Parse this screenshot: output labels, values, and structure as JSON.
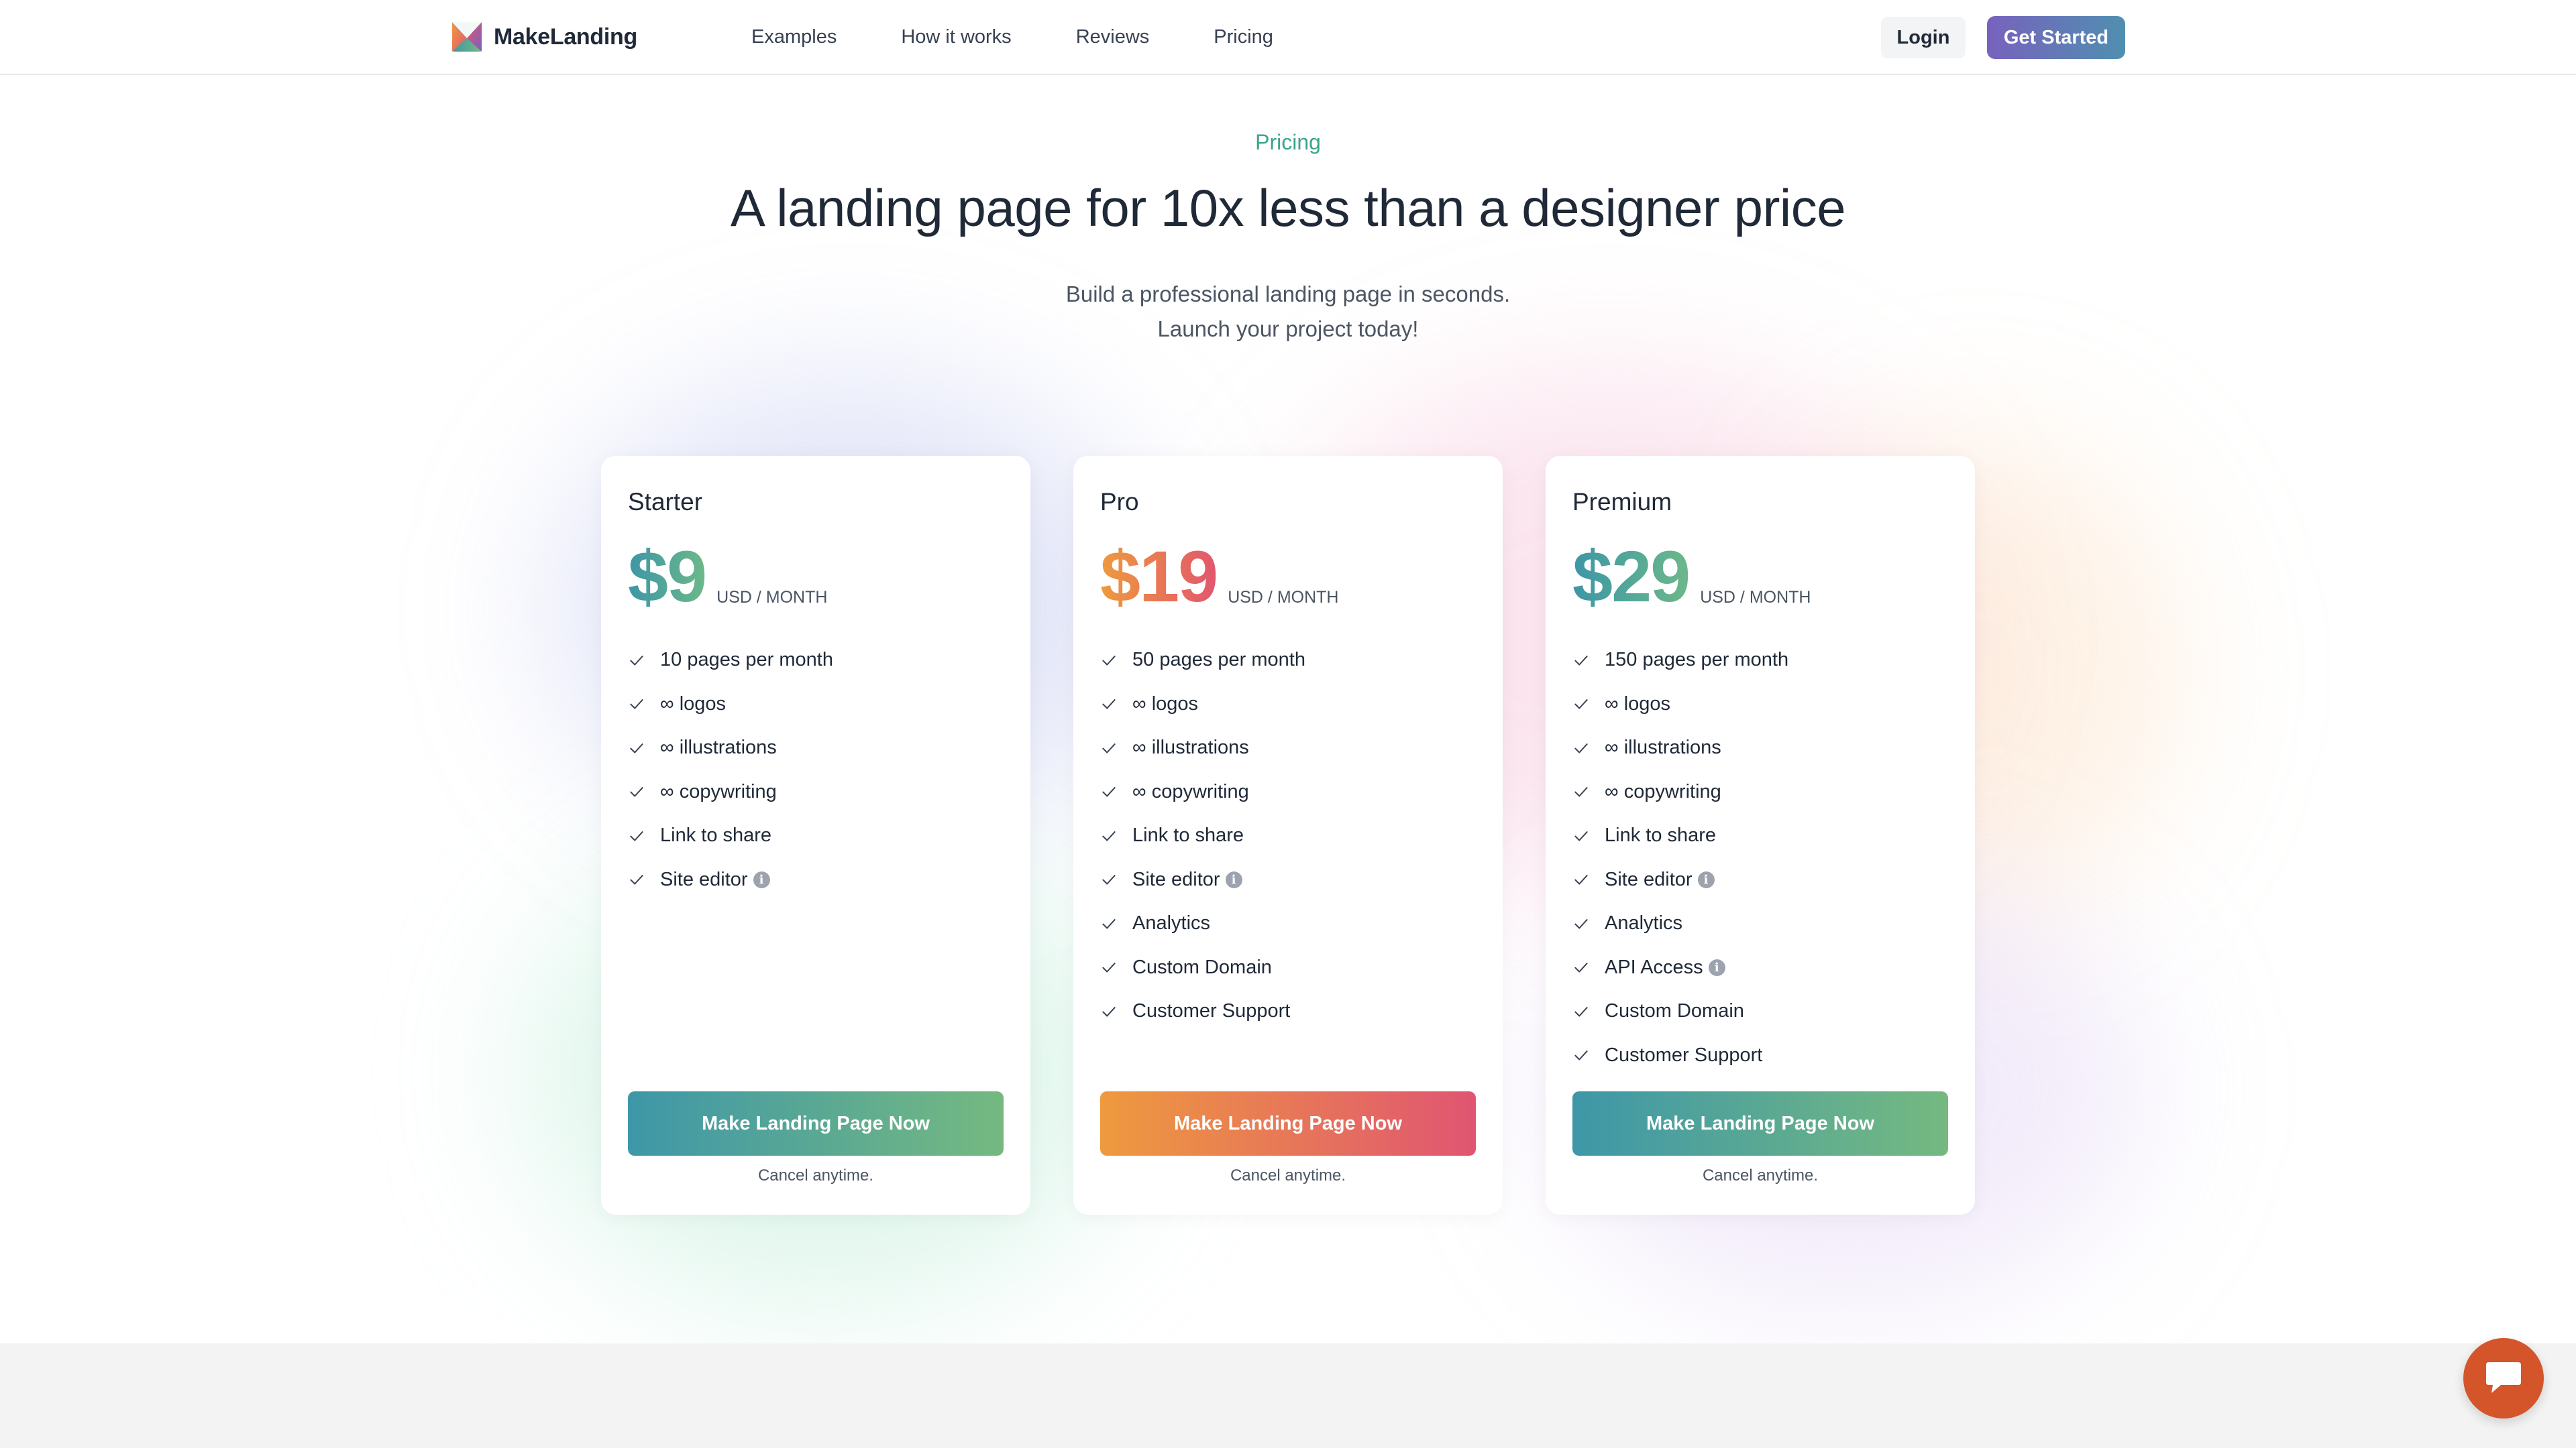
{
  "brand": {
    "name": "MakeLanding"
  },
  "nav": {
    "links": [
      "Examples",
      "How it works",
      "Reviews",
      "Pricing"
    ],
    "login": "Login",
    "get_started": "Get Started"
  },
  "hero": {
    "eyebrow": "Pricing",
    "headline": "A landing page for 10x less than a designer price",
    "sub_line1": "Build a professional landing page in seconds.",
    "sub_line2": "Launch your project today!"
  },
  "plans": [
    {
      "name": "Starter",
      "price": "$9",
      "unit": "USD / MONTH",
      "features": [
        {
          "text": "10 pages per month",
          "info": false
        },
        {
          "text": "∞ logos",
          "info": false
        },
        {
          "text": "∞ illustrations",
          "info": false
        },
        {
          "text": "∞ copywriting",
          "info": false
        },
        {
          "text": "Link to share",
          "info": false
        },
        {
          "text": "Site editor",
          "info": true
        }
      ],
      "cta": "Make Landing Page Now",
      "note": "Cancel anytime.",
      "accent": "#3d96a6"
    },
    {
      "name": "Pro",
      "price": "$19",
      "unit": "USD / MONTH",
      "features": [
        {
          "text": "50 pages per month",
          "info": false
        },
        {
          "text": "∞ logos",
          "info": false
        },
        {
          "text": "∞ illustrations",
          "info": false
        },
        {
          "text": "∞ copywriting",
          "info": false
        },
        {
          "text": "Link to share",
          "info": false
        },
        {
          "text": "Site editor",
          "info": true
        },
        {
          "text": "Analytics",
          "info": false
        },
        {
          "text": "Custom Domain",
          "info": false
        },
        {
          "text": "Customer Support",
          "info": false
        }
      ],
      "cta": "Make Landing Page Now",
      "note": "Cancel anytime.",
      "accent": "#ee9a3d"
    },
    {
      "name": "Premium",
      "price": "$29",
      "unit": "USD / MONTH",
      "features": [
        {
          "text": "150 pages per month",
          "info": false
        },
        {
          "text": "∞ logos",
          "info": false
        },
        {
          "text": "∞ illustrations",
          "info": false
        },
        {
          "text": "∞ copywriting",
          "info": false
        },
        {
          "text": "Link to share",
          "info": false
        },
        {
          "text": "Site editor",
          "info": true
        },
        {
          "text": "Analytics",
          "info": false
        },
        {
          "text": "API Access",
          "info": true
        },
        {
          "text": "Custom Domain",
          "info": false
        },
        {
          "text": "Customer Support",
          "info": false
        }
      ],
      "cta": "Make Landing Page Now",
      "note": "Cancel anytime.",
      "accent": "#3d96a6"
    }
  ],
  "icons": {
    "logo": "envelope-logo-icon",
    "check": "check-icon",
    "info": "info-icon",
    "chat": "chat-bubble-icon"
  },
  "colors": {
    "accent_green": "#3aa58a",
    "teal_gradient": [
      "#3e97a8",
      "#75b980"
    ],
    "warm_gradient": [
      "#ee9a3e",
      "#e05572"
    ],
    "purple_button": "#7862bd",
    "chat_button": "#d4552a"
  }
}
